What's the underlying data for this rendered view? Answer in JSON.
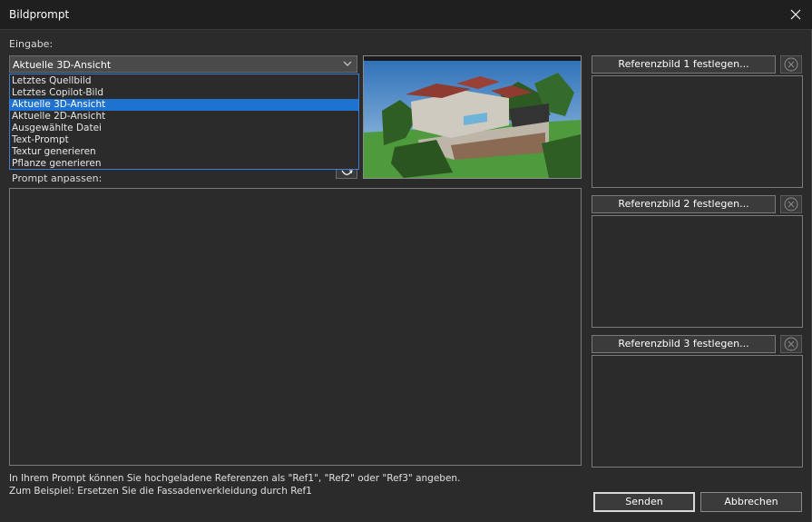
{
  "window": {
    "title": "Bildprompt"
  },
  "input": {
    "label": "Eingabe:",
    "selected": "Aktuelle 3D-Ansicht",
    "options": [
      "Letztes Quellbild",
      "Letztes Copilot-Bild",
      "Aktuelle 3D-Ansicht",
      "Aktuelle 2D-Ansicht",
      "Ausgewählte Datei",
      "Text-Prompt",
      "Textur generieren",
      "Pflanze generieren"
    ]
  },
  "prompt": {
    "label": "Prompt anpassen:",
    "value": ""
  },
  "references": [
    {
      "button": "Referenzbild 1 festlegen..."
    },
    {
      "button": "Referenzbild 2 festlegen..."
    },
    {
      "button": "Referenzbild 3 festlegen..."
    }
  ],
  "hint": {
    "line1": "In Ihrem Prompt können Sie hochgeladene Referenzen als \"Ref1\", \"Ref2\" oder \"Ref3\" angeben.",
    "line2": "Zum Beispiel: Ersetzen Sie die Fassadenverkleidung durch Ref1"
  },
  "buttons": {
    "send": "Senden",
    "cancel": "Abbrechen"
  },
  "icons": {
    "close": "close-icon",
    "dropdown": "chevron-down-icon",
    "refresh": "refresh-icon",
    "clear": "clear-circle-icon"
  },
  "colors": {
    "selection": "#1e73d0",
    "focus_border": "#3c7fd6"
  }
}
